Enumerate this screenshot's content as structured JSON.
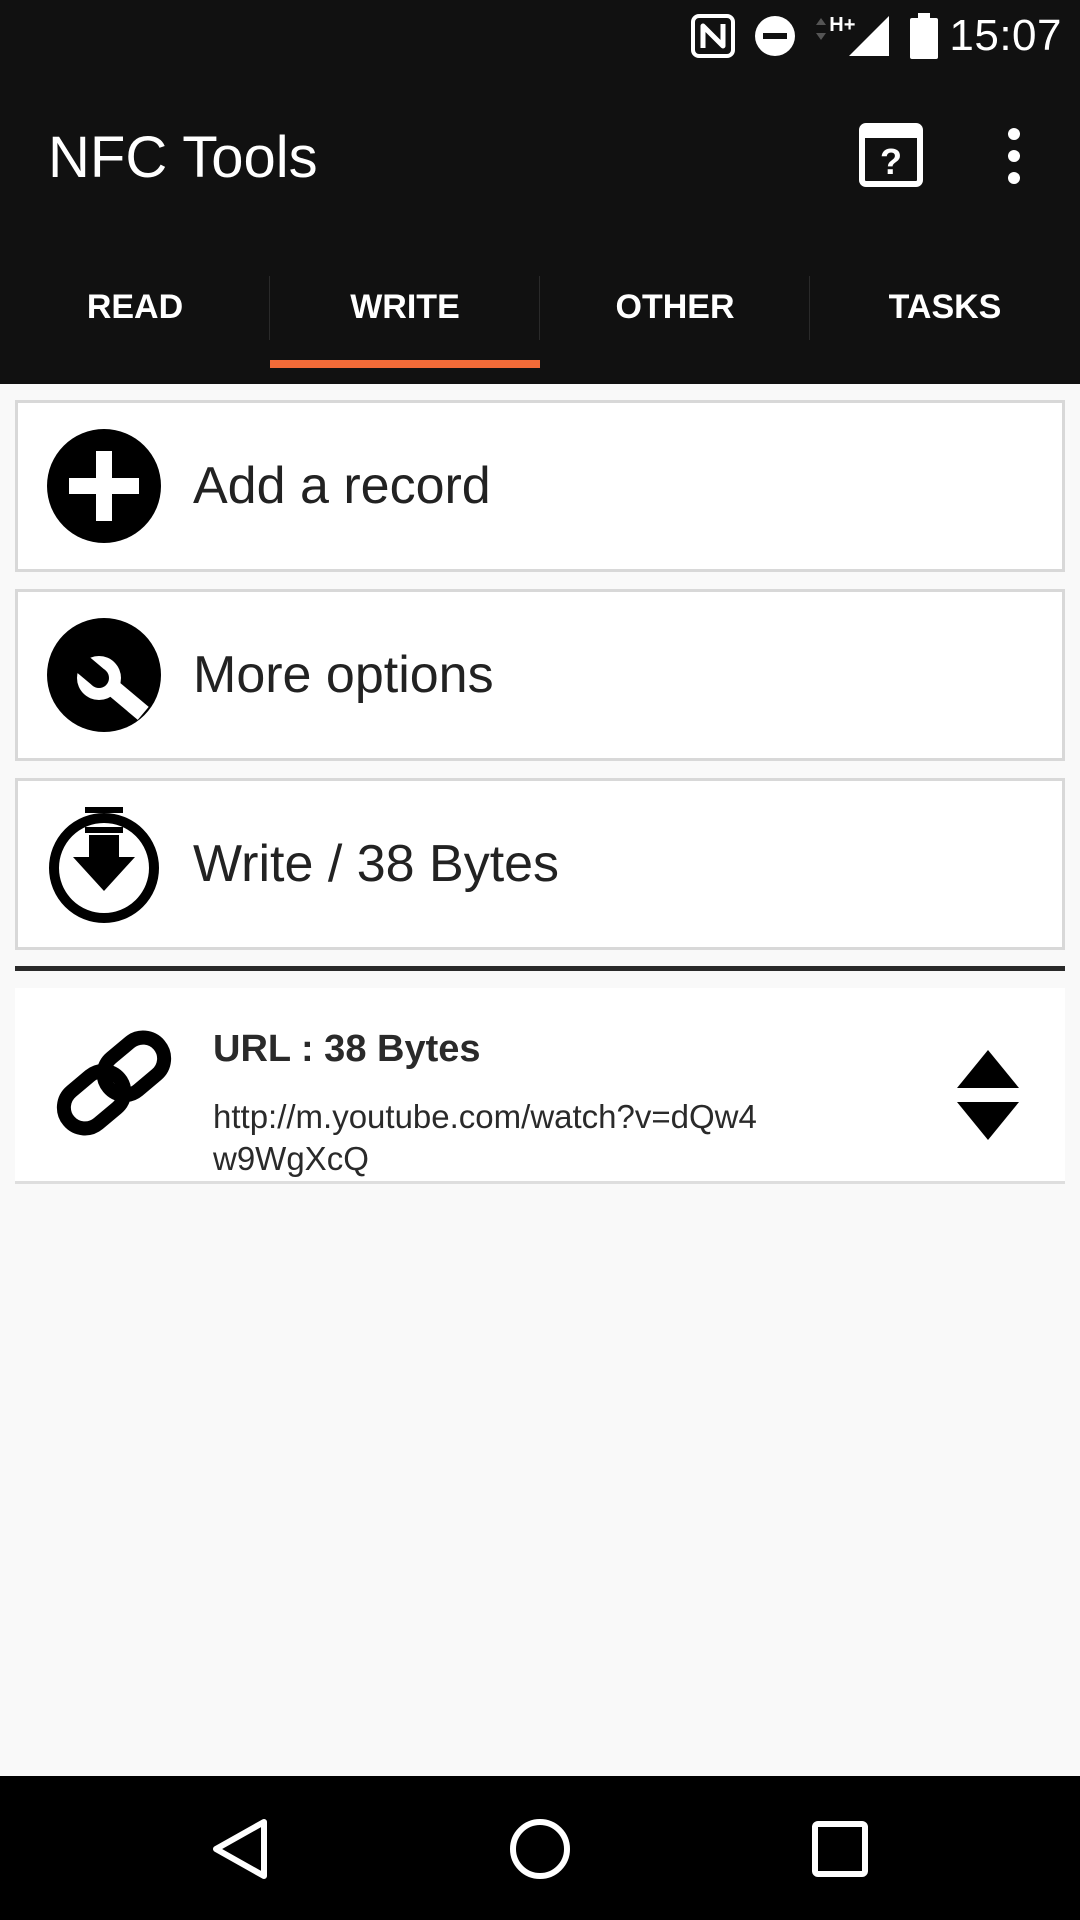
{
  "status_bar": {
    "time": "15:07",
    "network_label": "H+",
    "icons": [
      "nfc-icon",
      "do-not-disturb-icon",
      "signal-icon",
      "battery-icon"
    ]
  },
  "app_bar": {
    "title": "NFC Tools",
    "actions": [
      "help-icon",
      "overflow-menu-icon"
    ]
  },
  "tabs": [
    {
      "label": "READ",
      "selected": false
    },
    {
      "label": "WRITE",
      "selected": true
    },
    {
      "label": "OTHER",
      "selected": false
    },
    {
      "label": "TASKS",
      "selected": false
    }
  ],
  "actions": [
    {
      "label": "Add a record",
      "icon": "add-circle-icon"
    },
    {
      "label": "More options",
      "icon": "wrench-icon"
    },
    {
      "label": "Write / 38 Bytes",
      "icon": "write-download-icon"
    }
  ],
  "records": [
    {
      "title": "URL : 38 Bytes",
      "value": "http://m.youtube.com/watch?v=dQw4w9WgXcQ",
      "icon": "link-icon"
    }
  ],
  "colors": {
    "bar": "#111111",
    "accent": "#f26b38",
    "background": "#f9f9f9"
  },
  "nav_bar": [
    "back-icon",
    "home-icon",
    "recents-icon"
  ]
}
